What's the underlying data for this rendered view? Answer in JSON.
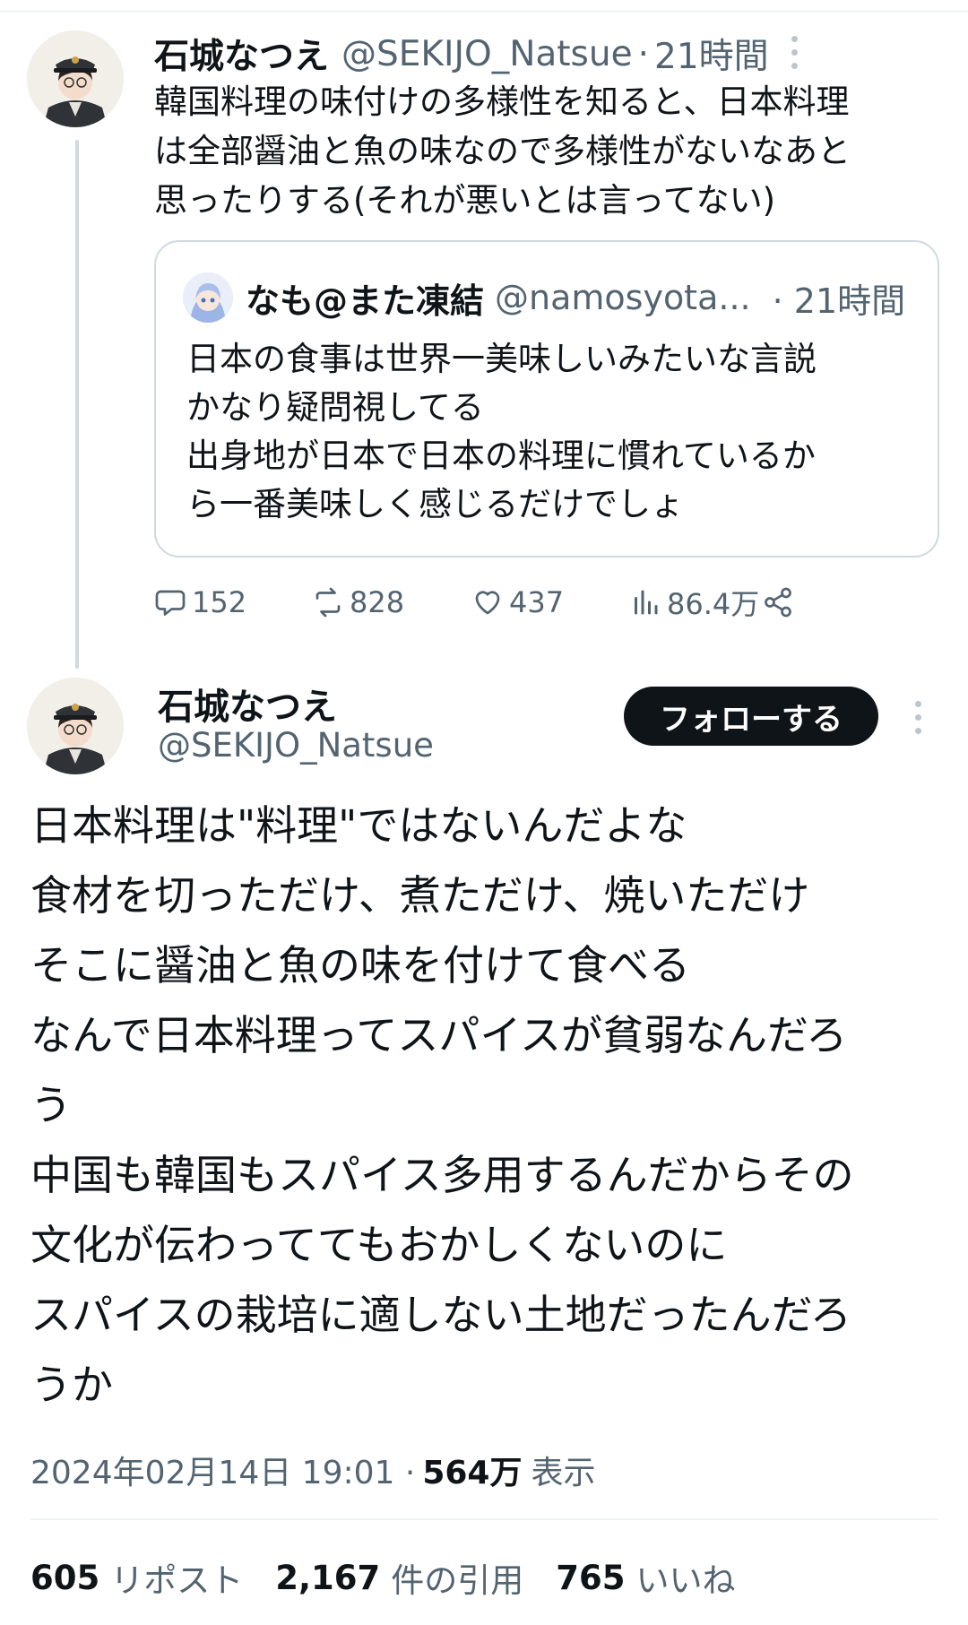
{
  "reply": {
    "name": "石城なつえ",
    "handle": "@SEKIJO_Natsue",
    "dot": "·",
    "time": "21時間",
    "text_lines": [
      "韓国料理の味付けの多様性を知ると、日本料理",
      "は全部醤油と魚の味なので多様性がないなあと",
      "思ったりする(それが悪いとは言ってない)"
    ],
    "quote": {
      "name": "なも@また凍結",
      "handle": "@namosyota...",
      "time": "· 21時間",
      "text_lines": [
        "日本の食事は世界一美味しいみたいな言説",
        "かなり疑問視してる",
        "出身地が日本で日本の料理に慣れているか",
        "ら一番美味しく感じるだけでしょ"
      ]
    },
    "actions": {
      "replies": "152",
      "reposts": "828",
      "likes": "437",
      "views": "86.4万"
    }
  },
  "main": {
    "name": "石城なつえ",
    "handle": "@SEKIJO_Natsue",
    "follow_label": "フォローする",
    "text_lines": [
      "日本料理は\"料理\"ではないんだよな",
      "食材を切っただけ、煮ただけ、焼いただけ",
      "そこに醤油と魚の味を付けて食べる",
      "なんで日本料理ってスパイスが貧弱なんだろ",
      "う",
      "中国も韓国もスパイス多用するんだからその",
      "文化が伝わっててもおかしくないのに",
      "スパイスの栽培に適しない土地だったんだろ",
      "うか"
    ],
    "timestamp": "2024年02月14日 19:01 ·",
    "views_count": "564万",
    "views_label": "表示",
    "stats": {
      "reposts_count": "605",
      "reposts_label": "リポスト",
      "quotes_count": "2,167",
      "quotes_label": "件の引用",
      "likes_count": "765",
      "likes_label": "いいね"
    }
  },
  "icons": {
    "reply": "comment-icon",
    "repost": "repost-icon",
    "like": "heart-icon",
    "views": "bar-chart-icon",
    "share": "share-icon",
    "more": "more-vertical-icon"
  },
  "colors": {
    "text": "#0f1419",
    "secondary": "#536471",
    "border": "#cfd9de",
    "button": "#0f1419"
  }
}
